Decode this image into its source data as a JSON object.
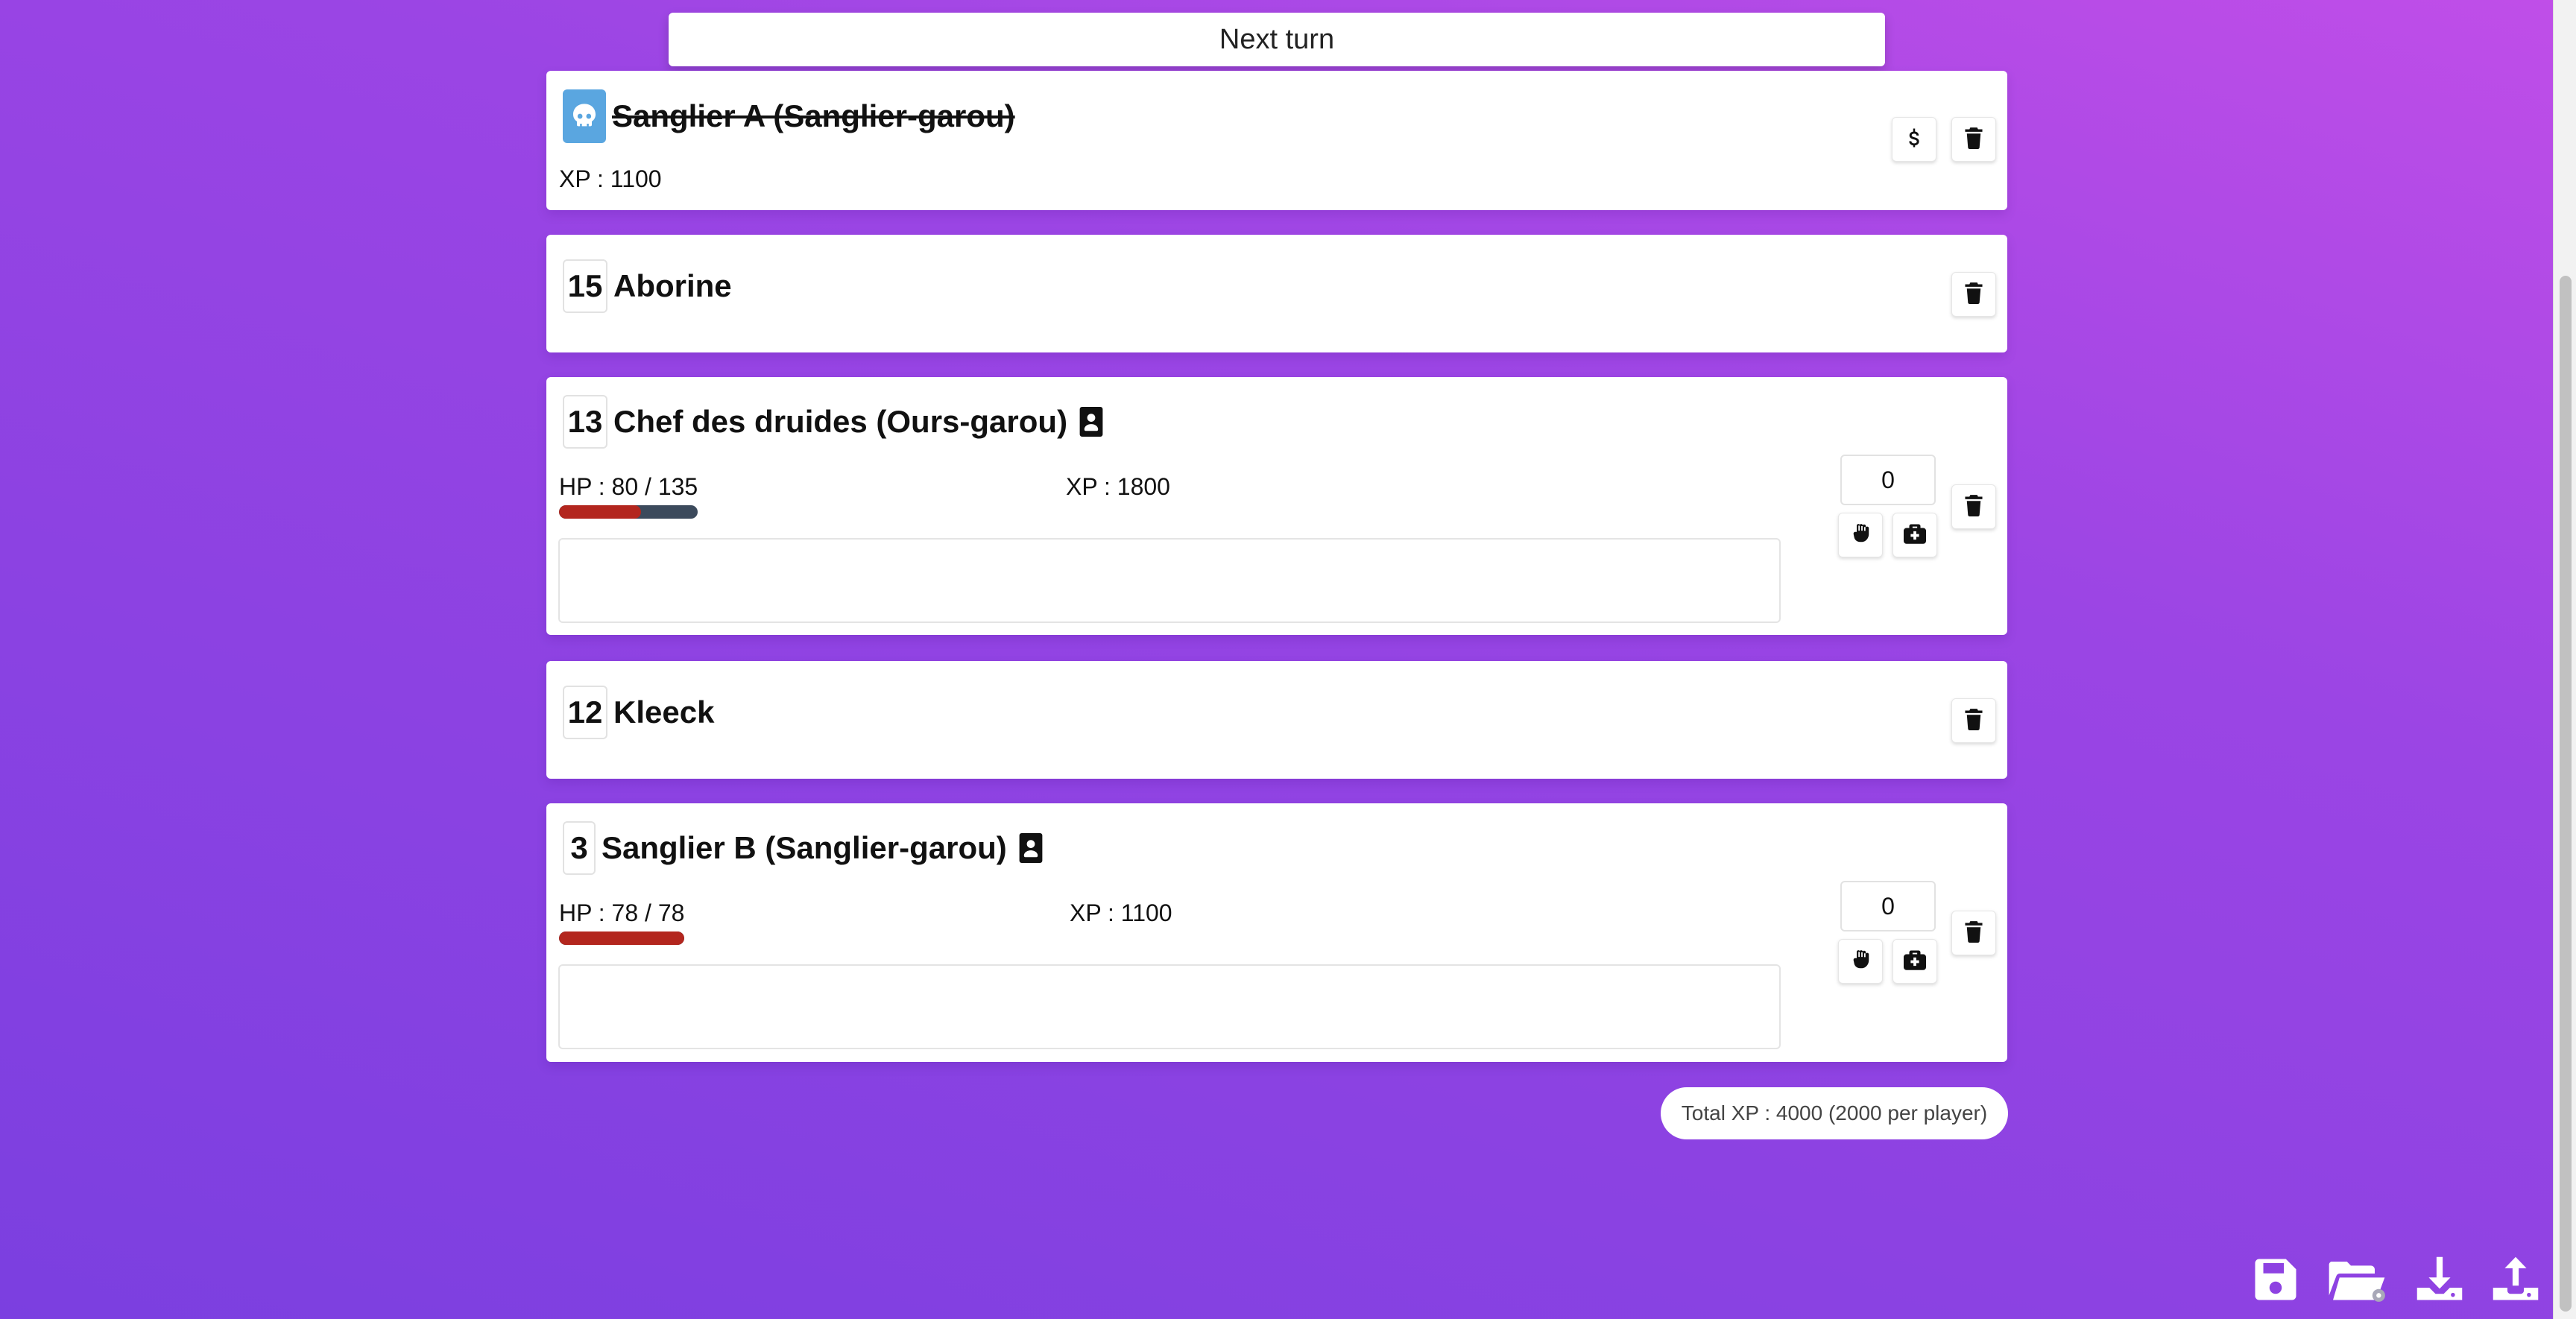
{
  "next_turn_label": "Next turn",
  "combatants": [
    {
      "initiative": "",
      "name": "Sanglier A (Sanglier-garou)",
      "dead": true,
      "xp": "XP : 1100"
    },
    {
      "initiative": "15",
      "name": "Aborine"
    },
    {
      "initiative": "13",
      "name": "Chef des druides (Ours-garou)",
      "hp": "HP : 80 / 135",
      "hp_fraction": 0.593,
      "xp": "XP : 1800",
      "damage_value": "0",
      "notes": ""
    },
    {
      "initiative": "12",
      "name": "Kleeck"
    },
    {
      "initiative": "3",
      "name": "Sanglier B (Sanglier-garou)",
      "hp": "HP : 78 / 78",
      "hp_fraction": 1.0,
      "xp": "XP : 1100",
      "damage_value": "0",
      "notes": ""
    }
  ],
  "total_xp": "Total XP : 4000 (2000 per player)",
  "colors": {
    "hp_fill": "#b3261e",
    "hp_track": "#3c4a5c",
    "skull_badge": "#5aa6e0"
  },
  "icons": {
    "card_actions": [
      "revive-icon",
      "trash-icon",
      "punch-icon",
      "medkit-icon",
      "character-sheet-icon",
      "skull-icon"
    ],
    "toolbar": [
      "save-icon",
      "open-folder-icon",
      "download-icon",
      "upload-icon"
    ]
  }
}
